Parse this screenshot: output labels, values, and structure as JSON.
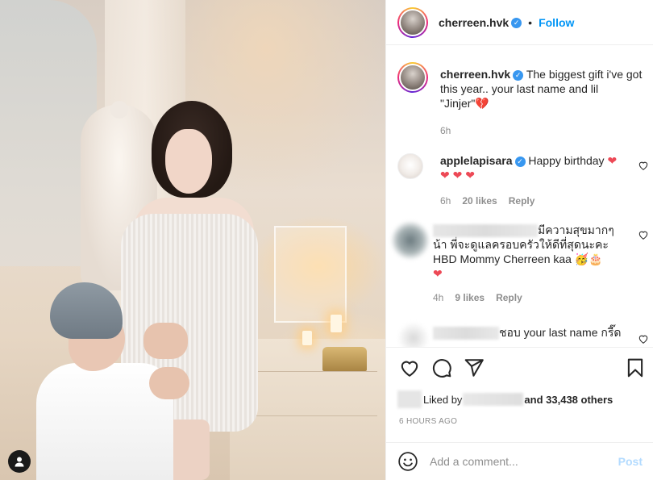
{
  "header": {
    "username": "cherreen.hvk",
    "separator": "•",
    "follow_label": "Follow"
  },
  "caption": {
    "username": "cherreen.hvk",
    "text": "The biggest gift i've got this year.. your last name and lil \"Jinjer\"",
    "emoji": "💔",
    "time": "6h"
  },
  "comments": [
    {
      "username": "applelapisara",
      "text": "Happy birthday",
      "hearts": "❤ ❤ ❤",
      "trailing_heart": "❤",
      "time": "6h",
      "likes": "20 likes",
      "reply": "Reply"
    },
    {
      "text_line1": "มีความสุขมากๆ",
      "text_rest": "น้า พี่จะดูแลครอบครัวให้ดีที่สุดนะคะ HBD Mommy Cherreen kaa 🥳🎂",
      "heart": "❤",
      "time": "4h",
      "likes": "9 likes",
      "reply": "Reply"
    },
    {
      "text": "ชอบ your last name กรี๊ด"
    }
  ],
  "likes": {
    "prefix": "Liked by",
    "suffix": "and 33,438 others"
  },
  "timestamp": "6 HOURS AGO",
  "add_comment": {
    "placeholder": "Add a comment...",
    "post_label": "Post"
  },
  "colors": {
    "accent": "#0095f6",
    "verified": "#3897f0",
    "heart": "#ed4956",
    "post_disabled": "#b3dbff"
  }
}
